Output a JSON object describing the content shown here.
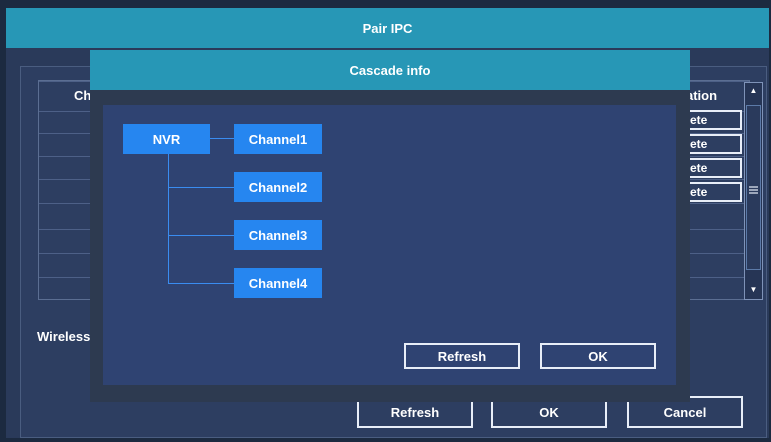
{
  "outer_window": {
    "title": "Pair IPC",
    "column_left_header": "Ch",
    "column_right_header": "ation",
    "row_buttons": [
      "ete",
      "ete",
      "ete",
      "ete"
    ],
    "wireless_label": "Wireless",
    "refresh_label": "Refresh",
    "ok_label": "OK",
    "cancel_label": "Cancel"
  },
  "modal": {
    "title": "Cascade info",
    "tree": {
      "root": "NVR",
      "channels": [
        "Channel1",
        "Channel2",
        "Channel3",
        "Channel4"
      ]
    },
    "refresh_label": "Refresh",
    "ok_label": "OK"
  },
  "colors": {
    "titlebar": "#2797b6",
    "node": "#2686f0",
    "panel": "#2f4372",
    "background": "#1c2a40"
  },
  "icons": {
    "scroll_up": "scroll-up-icon",
    "scroll_down": "scroll-down-icon",
    "scroll_grip": "scroll-grip-icon"
  }
}
